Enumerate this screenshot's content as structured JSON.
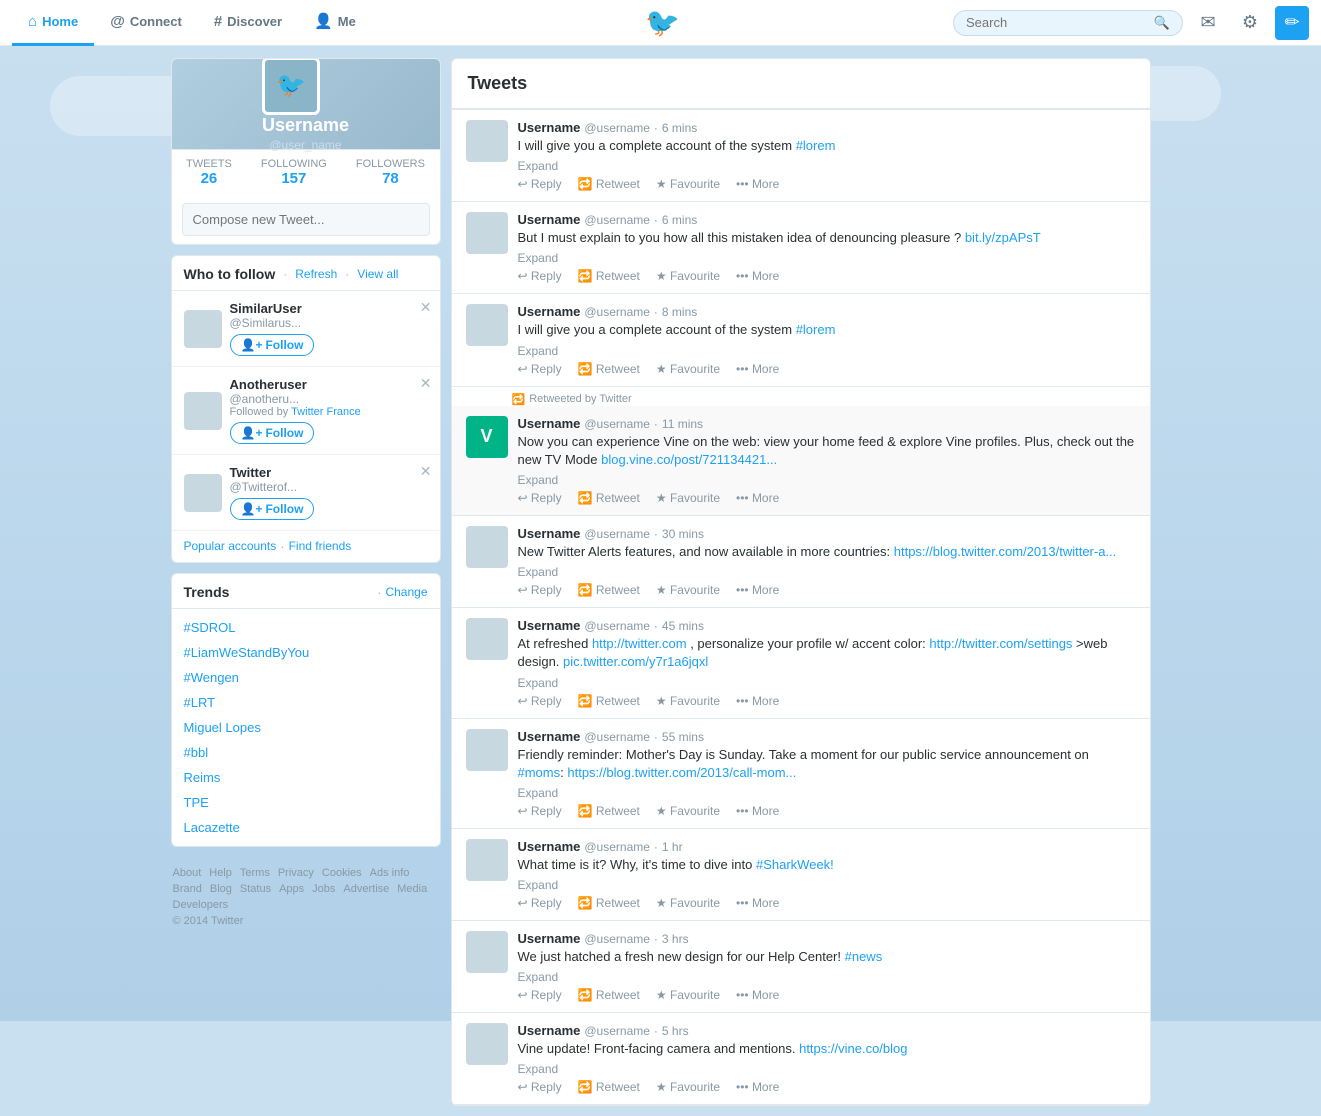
{
  "nav": {
    "home_label": "Home",
    "connect_label": "Connect",
    "discover_label": "Discover",
    "me_label": "Me",
    "search_placeholder": "Search",
    "twitter_logo": "🐦"
  },
  "profile": {
    "name": "Username",
    "handle": "@user_name",
    "tweets_label": "TWEETS",
    "tweets_count": "26",
    "following_label": "FOLLOWING",
    "following_count": "157",
    "followers_label": "FOLLOWERS",
    "followers_count": "78",
    "compose_placeholder": "Compose new Tweet..."
  },
  "who_to_follow": {
    "title": "Who to follow",
    "refresh_label": "Refresh",
    "view_all_label": "View all",
    "accounts": [
      {
        "name": "SimilarUser",
        "handle": "@Similarus...",
        "followed_by": ""
      },
      {
        "name": "Anotheruser",
        "handle": "@anotheru...",
        "followed_by": "Twitter France"
      },
      {
        "name": "Twitter",
        "handle": "@Twitterof...",
        "followed_by": ""
      }
    ],
    "follow_label": "Follow",
    "popular_accounts_label": "Popular accounts",
    "find_friends_label": "Find friends"
  },
  "trends": {
    "title": "Trends",
    "change_label": "Change",
    "items": [
      "#SDROL",
      "#LiamWeStandByYou",
      "#Wengen",
      "#LRT",
      "Miguel Lopes",
      "#bbl",
      "Reims",
      "TPE",
      "Lacazette"
    ]
  },
  "footer": {
    "copyright": "© 2014 Twitter",
    "links": [
      "About",
      "Help",
      "Terms",
      "Privacy",
      "Cookies",
      "Ads info",
      "Brand",
      "Blog",
      "Status",
      "Apps",
      "Jobs",
      "Advertise",
      "Media",
      "Developers"
    ]
  },
  "tweets": {
    "title": "Tweets",
    "items": [
      {
        "id": 1,
        "username": "Username",
        "handle": "@username",
        "time": "6 mins",
        "text": "I will give you a complete account of the system ",
        "link_text": "#lorem",
        "link_href": "#",
        "expand": "Expand",
        "reply": "Reply",
        "retweet": "Retweet",
        "favourite": "Favourite",
        "more": "More",
        "retweeted_by": ""
      },
      {
        "id": 2,
        "username": "Username",
        "handle": "@username",
        "time": "6 mins",
        "text": "But I must explain to you how all this mistaken idea of denouncing pleasure ? ",
        "link_text": "bit.ly/zpAPsT",
        "link_href": "#",
        "expand": "Expand",
        "reply": "Reply",
        "retweet": "Retweet",
        "favourite": "Favourite",
        "more": "More",
        "retweeted_by": ""
      },
      {
        "id": 3,
        "username": "Username",
        "handle": "@username",
        "time": "8 mins",
        "text": "I will give you a complete account of the system ",
        "link_text": "#lorem",
        "link_href": "#",
        "expand": "Expand",
        "reply": "Reply",
        "retweet": "Retweet",
        "favourite": "Favourite",
        "more": "More",
        "retweeted_by": ""
      },
      {
        "id": 4,
        "username": "Username",
        "handle": "@username",
        "time": "11 mins",
        "text": "Now you can experience Vine on the web: view your home feed & explore Vine profiles. Plus, check out the new TV Mode  ",
        "link_text": "blog.vine.co/post/721134421...",
        "link_href": "#",
        "expand": "Expand",
        "reply": "Reply",
        "retweet": "Retweet",
        "favourite": "Favourite",
        "more": "More",
        "retweeted_by": "Retweeted by Twitter",
        "is_vine": true
      },
      {
        "id": 5,
        "username": "Username",
        "handle": "@username",
        "time": "30 mins",
        "text": "New Twitter Alerts features, and now available in more countries: ",
        "link_text": "https://blog.twitter.com/2013/twitter-a...",
        "link_href": "#",
        "expand": "Expand",
        "reply": "Reply",
        "retweet": "Retweet",
        "favourite": "Favourite",
        "more": "More",
        "retweeted_by": ""
      },
      {
        "id": 6,
        "username": "Username",
        "handle": "@username",
        "time": "45 mins",
        "text": "At refreshed ",
        "link_text": "http://twitter.com",
        "link_href": "#",
        "text2": " , personalize your profile w/ accent color: ",
        "link_text2": "http://twitter.com/settings",
        "link_href2": "#",
        "text3": " >web design. ",
        "link_text3": "pic.twitter.com/y7r1a6jqxl",
        "link_href3": "#",
        "expand": "Expand",
        "reply": "Reply",
        "retweet": "Retweet",
        "favourite": "Favourite",
        "more": "More",
        "retweeted_by": "",
        "complex": true
      },
      {
        "id": 7,
        "username": "Username",
        "handle": "@username",
        "time": "55 mins",
        "text": "Friendly reminder: Mother's Day is Sunday. Take a moment for our public service announcement on ",
        "link_text": "#moms",
        "link_href": "#",
        "text2": ": ",
        "link_text2": "https://blog.twitter.com/2013/call-mom...",
        "link_href2": "#",
        "expand": "Expand",
        "reply": "Reply",
        "retweet": "Retweet",
        "favourite": "Favourite",
        "more": "More",
        "retweeted_by": ""
      },
      {
        "id": 8,
        "username": "Username",
        "handle": "@username",
        "time": "1 hr",
        "text": "What time is it? Why, it's time to dive into ",
        "link_text": "#SharkWeek!",
        "link_href": "#",
        "expand": "Expand",
        "reply": "Reply",
        "retweet": "Retweet",
        "favourite": "Favourite",
        "more": "More",
        "retweeted_by": ""
      },
      {
        "id": 9,
        "username": "Username",
        "handle": "@username",
        "time": "3 hrs",
        "text": "We just hatched a fresh new design for our Help Center! ",
        "link_text": "#news",
        "link_href": "#",
        "expand": "Expand",
        "reply": "Reply",
        "retweet": "Retweet",
        "favourite": "Favourite",
        "more": "More",
        "retweeted_by": ""
      },
      {
        "id": 10,
        "username": "Username",
        "handle": "@username",
        "time": "5 hrs",
        "text": "Vine update! Front-facing camera and mentions. ",
        "link_text": "https://vine.co/blog",
        "link_href": "#",
        "expand": "Expand",
        "reply": "Reply",
        "retweet": "Retweet",
        "favourite": "Favourite",
        "more": "More",
        "retweeted_by": ""
      }
    ]
  }
}
